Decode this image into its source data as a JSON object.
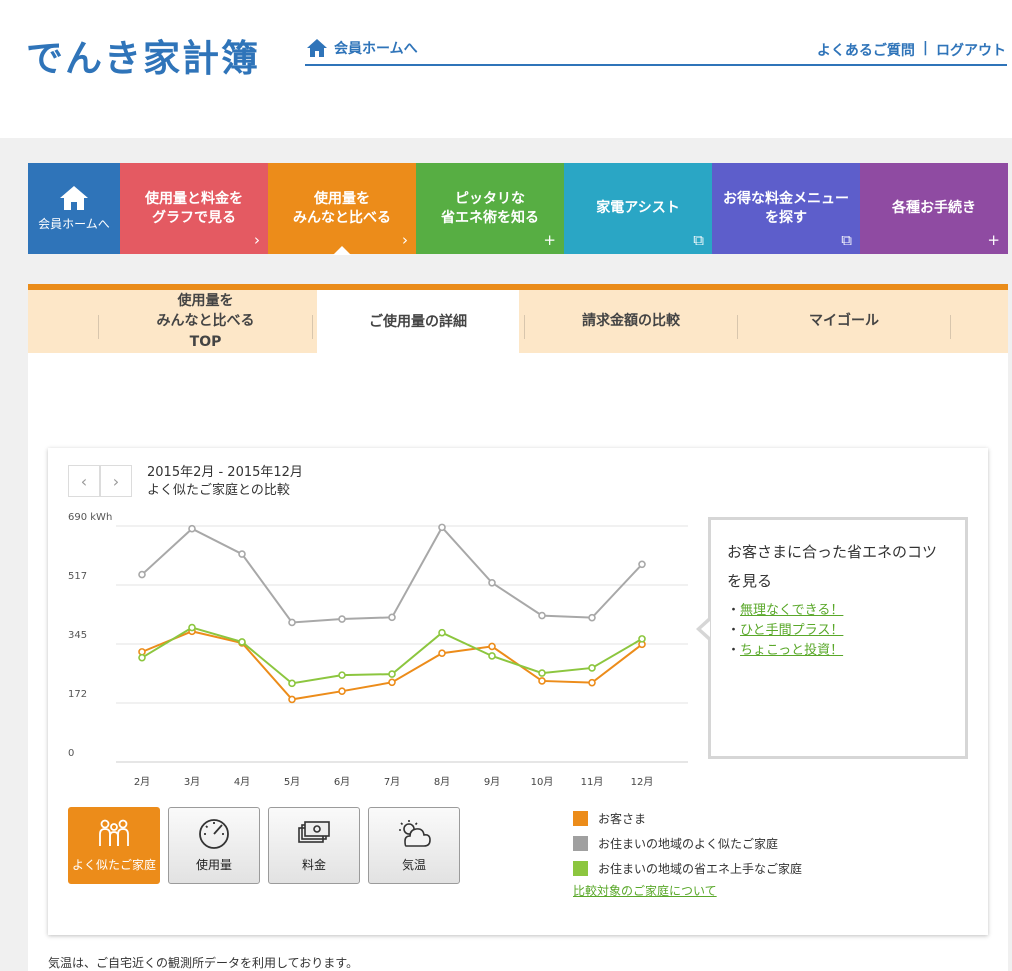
{
  "header": {
    "logo": "でんき家計簿",
    "home_link": "会員ホームへ",
    "faq": "よくあるご質問",
    "separator": "|",
    "logout": "ログアウト",
    "accent_color": "#2f74b9"
  },
  "nav": {
    "items": [
      {
        "label": "会員ホームへ",
        "color": "#2f74b9",
        "icon": "home-icon"
      },
      {
        "label_1": "使用量と料金を",
        "label_2": "グラフで見る",
        "color": "#e45a62",
        "glyph": "›"
      },
      {
        "label_1": "使用量を",
        "label_2": "みんなと比べる",
        "color": "#ec8c1a",
        "glyph": "›",
        "active": true
      },
      {
        "label_1": "ピッタリな",
        "label_2": "省エネ術を知る",
        "color": "#57ae43",
        "glyph": "+"
      },
      {
        "label": "家電アシスト",
        "color": "#2aa6c5",
        "glyph": "⧉"
      },
      {
        "label_1": "お得な料金メニュー",
        "label_2": "を探す",
        "color": "#5d5ecb",
        "glyph": "⧉"
      },
      {
        "label": "各種お手続き",
        "color": "#8f4ba2",
        "glyph": "+"
      }
    ]
  },
  "subtabs": {
    "tab1_l1": "使用量を",
    "tab1_l2": "みんなと比べる",
    "tab1_l3": "TOP",
    "tab2": "ご使用量の詳細",
    "tab3": "請求金額の比較",
    "tab4": "マイゴール"
  },
  "chart_panel": {
    "prev": "‹",
    "next": "›",
    "period": "2015年2月 - 2015年12月",
    "subtitle": "よく似たご家庭との比較"
  },
  "chart_data": {
    "type": "line",
    "categories": [
      "2月",
      "3月",
      "4月",
      "5月",
      "6月",
      "7月",
      "8月",
      "9月",
      "10月",
      "11月",
      "12月"
    ],
    "y_ticks": [
      "0",
      "172",
      "345",
      "517",
      "690 kWh"
    ],
    "ylim": [
      0,
      690
    ],
    "grid": true,
    "series": [
      {
        "name": "お客さま",
        "color": "#ec8c1a",
        "values": [
          322,
          382,
          348,
          183,
          207,
          233,
          318,
          338,
          237,
          232,
          344
        ]
      },
      {
        "name": "お住まいの地域のよく似たご家庭",
        "color": "#a8a8a8",
        "values": [
          548,
          682,
          608,
          408,
          418,
          423,
          686,
          524,
          428,
          422,
          578
        ]
      },
      {
        "name": "お住まいの地域の省エネ上手なご家庭",
        "color": "#8cc63f",
        "values": [
          305,
          393,
          351,
          230,
          254,
          257,
          378,
          310,
          260,
          275,
          360
        ]
      }
    ]
  },
  "tips": {
    "title": "お客さまに合った省エネのコツを見る",
    "bullet": "・",
    "links": [
      "無理なくできる！",
      "ひと手間プラス！",
      "ちょこっと投資！"
    ]
  },
  "modes": {
    "similar": "よく似たご家庭",
    "usage": "使用量",
    "cost": "料金",
    "temp": "気温"
  },
  "legend": {
    "link": "比較対象のご家庭について"
  },
  "footnote": "気温は、ご自宅近くの観測所データを利用しております。"
}
